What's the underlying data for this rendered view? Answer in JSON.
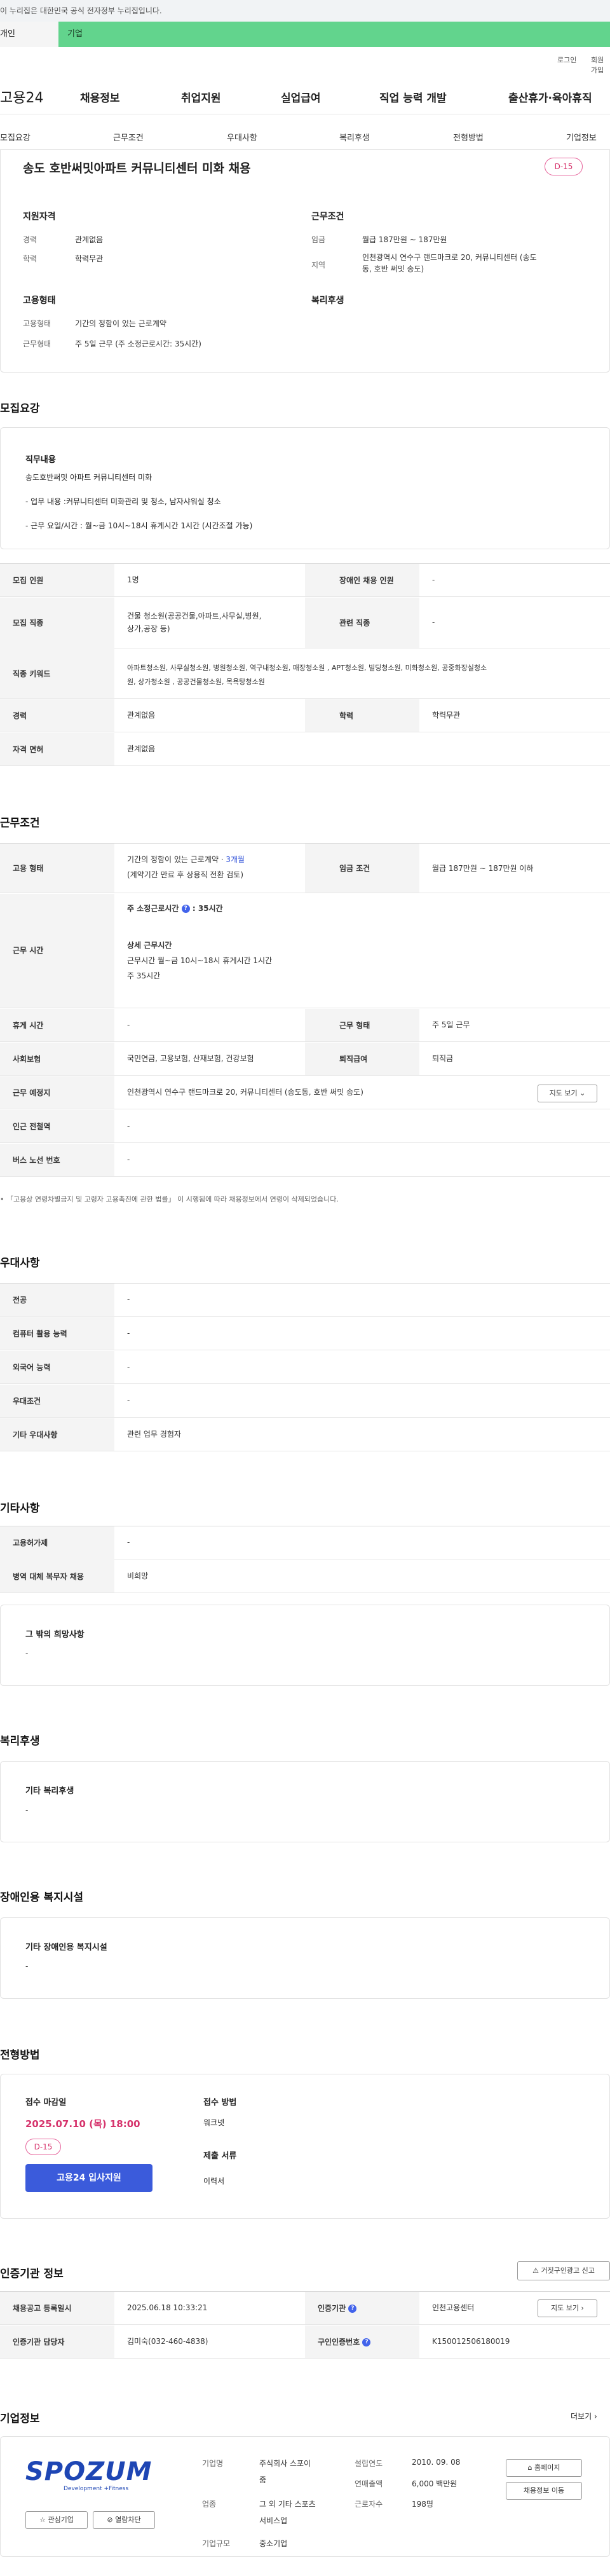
{
  "gov_strip": {
    "text": "이 누리집은 대한민국 공식 전자정부 누리집입니다."
  },
  "tabs": {
    "personal": "개인",
    "company": "기업"
  },
  "util": {
    "login": "로그인",
    "signup": "회원가입"
  },
  "logo": "고용24",
  "gnb": [
    "채용정보",
    "취업지원",
    "실업급여",
    "직업 능력 개발",
    "출산휴가·육아휴직"
  ],
  "subnav": [
    "모집요강",
    "근무조건",
    "우대사항",
    "복리후생",
    "전형방법",
    "기업정보"
  ],
  "summary": {
    "title": "송도 호반써밋아파트 커뮤니티센터 미화 채용",
    "dday": "D-15",
    "qualification_title": "지원자격",
    "career_label": "경력",
    "career_value": "관계없음",
    "education_label": "학력",
    "education_value": "학력무관",
    "employment_title": "고용형태",
    "emp_type_label": "고용형태",
    "emp_type_value": "기간의 정함이 있는 근로계약",
    "work_type_label": "근무형태",
    "work_type_value": "주 5일 근무 (주 소정근로시간: 35시간)",
    "conditions_title": "근무조건",
    "wage_label": "임금",
    "wage_value": "월급 187만원 ~ 187만원",
    "region_label": "지역",
    "region_value_1": "인천광역시 연수구 랜드마크로 20, 커뮤니티센터 (송도",
    "region_value_2": "동, 호반 써밋 송도)",
    "welfare_title": "복리후생"
  },
  "recruit": {
    "section_title": "모집요강",
    "duty_title": "직무내용",
    "duty_lines": [
      "송도호반써밋 아파트 커뮤니티센터 미화",
      "- 업무 내용 :커뮤니티센터 미화관리 및 청소, 남자샤워실 청소",
      "- 근무 요일/시간 : 월~금 10시~18시 휴게시간 1시간 (시간조절 가능)"
    ],
    "table": {
      "headcount_label": "모집 인원",
      "headcount_value": "1명",
      "disabled_label": "장애인 채용 인원",
      "disabled_value": "-",
      "job_label": "모집 직종",
      "job_value_1": "건물 청소원(공공건물,아파트,사무실,병원,",
      "job_value_2": "상가,공장 등)",
      "related_label": "관련 직종",
      "related_value": "-",
      "keyword_label": "직종 키워드",
      "keyword_lines": [
        "아파트청소원, 사무실청소원, 병원청소원, 역구내청소원, 매장청소원 , APT청소원, 빌딩청소원, 미화청소원, 공중화장실청소",
        "원, 상가청소원 , 공공건물청소원, 목욕탕청소원"
      ],
      "career_label": "경력",
      "career_value": "관계없음",
      "edu_label": "학력",
      "edu_value": "학력무관",
      "license_label": "자격 면허",
      "license_value": "관계없음"
    }
  },
  "conditions": {
    "section_title": "근무조건",
    "emp_label": "고용 형태",
    "emp_value_1": "기간의 정함이 있는 근로계약 · ",
    "emp_value_highlight": "3개월",
    "emp_value_2": "(계약기간 만료 후 상용직 전환 검토)",
    "wage_label": "임금 조건",
    "wage_value": "월급 187만원 ~ 187만원 이하",
    "time_label": "근무 시간",
    "time_basic_label": "주 소정근로시간",
    "time_basic_value": ": 35시간",
    "time_detail_title": "상세 근무시간",
    "time_detail_1": "근무시간 월~금 10시~18시 휴게시간 1시간",
    "time_detail_2": "주 35시간",
    "holiday_label": "휴게 시간",
    "holiday_value": "-",
    "worktype_label": "근무 형태",
    "worktype_value": "주 5일 근무",
    "insurance_label": "사회보험",
    "insurance_value": "국민연금, 고용보험, 산재보험, 건강보험",
    "severance_label": "퇴직급여",
    "severance_value": "퇴직금",
    "place_label": "근무 예정지",
    "place_value": "인천광역시 연수구 랜드마크로 20, 커뮤니티센터 (송도동, 호반 써밋 송도)",
    "map_button": "지도 보기",
    "subway_label": "인근 전철역",
    "subway_value": "-",
    "bus_label": "버스 노선 번호",
    "bus_value": "-",
    "note": "「고용상 연령차별금지 및 고령자 고용촉진에 관한 법률」 이 시행됨에 따라 채용정보에서 연령이 삭제되었습니다."
  },
  "prefer": {
    "section_title": "우대사항",
    "rows": [
      {
        "label": "전공",
        "value": "-"
      },
      {
        "label": "컴퓨터 활용 능력",
        "value": "-"
      },
      {
        "label": "외국어 능력",
        "value": "-"
      },
      {
        "label": "우대조건",
        "value": "-"
      },
      {
        "label": "기타 우대사항",
        "value": "관련 업무 경험자"
      }
    ]
  },
  "etc": {
    "section_title": "기타사항",
    "rows": [
      {
        "label": "고용허가제",
        "value": "-"
      },
      {
        "label": "병역 대체 복무자 채용",
        "value": "비희망"
      }
    ],
    "other_title": "그 밖의 희망사항",
    "other_value": "-"
  },
  "welfare": {
    "section_title": "복리후생",
    "card_title": "기타 복리후생",
    "card_value": "-"
  },
  "disabled": {
    "section_title": "장애인용 복지시설",
    "card_title": "기타 장애인용 복지시설",
    "card_value": "-"
  },
  "selection": {
    "section_title": "전형방법",
    "deadline_title": "접수 마감일",
    "deadline_value": "2025.07.10 (목) 18:00",
    "dday": "D-15",
    "apply_button": "고용24 입사지원",
    "method_title": "접수 방법",
    "method_value": "워크넷",
    "docs_title": "제출 서류",
    "docs_value": "이력서"
  },
  "agency": {
    "section_title": "인증기관 정보",
    "report_button": "거짓구인광고 신고",
    "reg_label": "채용공고 등록일시",
    "reg_value": "2025.06.18 10:33:21",
    "agency_label": "인증기관",
    "agency_value": "인천고용센터",
    "map_button": "지도 보기",
    "manager_label": "인증기관 담당자",
    "manager_value": "김미숙(032-460-4838)",
    "number_label": "구인인증번호",
    "number_value": "K150012506180019"
  },
  "company": {
    "section_title": "기업정보",
    "more": "더보기",
    "logo_main": "SPOZUM",
    "logo_sub": "Development  +Fitness",
    "interest_button": "관심기업",
    "block_button": "열람차단",
    "name_label": "기업명",
    "name_value_1": "주식회사 스포이",
    "name_value_2": "줌",
    "industry_label": "업종",
    "industry_value_1": "그 외 기타 스포츠",
    "industry_value_2": "서비스업",
    "size_label": "기업규모",
    "size_value": "중소기업",
    "founded_label": "설립연도",
    "founded_value": "2010. 09. 08",
    "sales_label": "연매출액",
    "sales_value": "6,000 백만원",
    "employees_label": "근로자수",
    "employees_value": "198명",
    "homepage_button": "홈페이지",
    "jobs_button": "채용정보 이동"
  },
  "colors": {
    "tab_company": "#62d48d",
    "primary": "#3b5bdb",
    "dday": "#d6336c"
  }
}
